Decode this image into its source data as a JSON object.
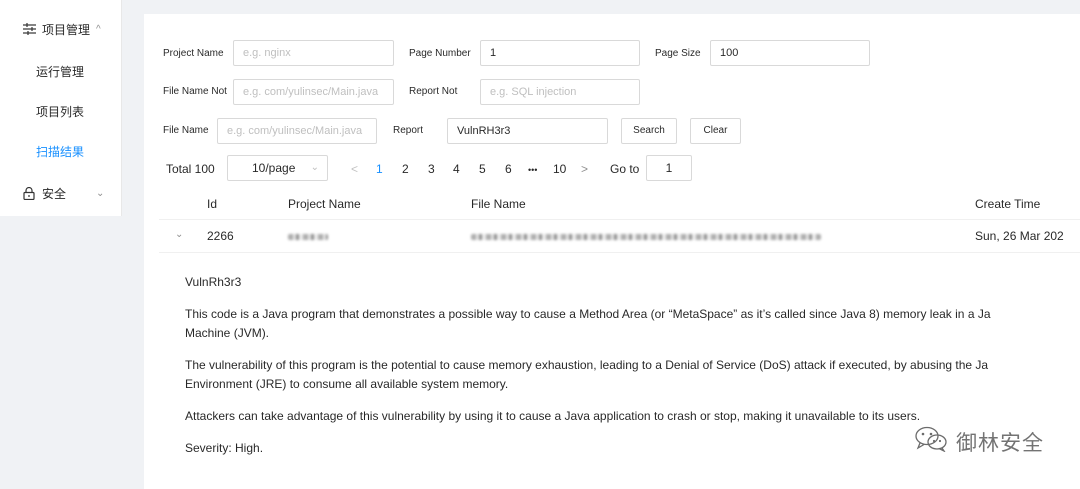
{
  "sidebar": {
    "group_project": {
      "label": "项目管理",
      "arrow": "^"
    },
    "items": [
      {
        "label": "运行管理"
      },
      {
        "label": "项目列表"
      },
      {
        "label": "扫描结果",
        "active": true
      }
    ],
    "group_security": {
      "label": "安全",
      "arrow": "⌄"
    }
  },
  "filters": {
    "project_name": {
      "label": "Project Name",
      "placeholder": "e.g. nginx",
      "value": ""
    },
    "page_number": {
      "label": "Page Number",
      "value": "1"
    },
    "page_size": {
      "label": "Page Size",
      "value": "100"
    },
    "file_name_not": {
      "label": "File Name Not",
      "placeholder": "e.g. com/yulinsec/Main.java",
      "value": ""
    },
    "report_not": {
      "label": "Report Not",
      "placeholder": "e.g. SQL injection",
      "value": ""
    },
    "file_name": {
      "label": "File Name",
      "placeholder": "e.g. com/yulinsec/Main.java",
      "value": ""
    },
    "report": {
      "label": "Report",
      "value": "VulnRH3r3"
    },
    "search_label": "Search",
    "clear_label": "Clear"
  },
  "pagination": {
    "total": "Total 100",
    "page_size_select": "10/page",
    "prev": "<",
    "pages": [
      "1",
      "2",
      "3",
      "4",
      "5",
      "6"
    ],
    "ellipsis": "•••",
    "last": "10",
    "next": ">",
    "goto_label": "Go to",
    "goto_value": "1"
  },
  "table": {
    "columns": [
      "Id",
      "Project Name",
      "File Name",
      "Create Time"
    ],
    "rows": [
      {
        "id": "2266",
        "create_time": "Sun, 26 Mar 202"
      }
    ]
  },
  "detail": {
    "title": "VulnRh3r3",
    "p1a": "This code is a Java program that demonstrates a possible way to cause a Method Area (or “MetaSpace” as it’s called since Java 8) memory leak in a Ja",
    "p1b": "Machine (JVM).",
    "p2a": "The vulnerability of this program is the potential to cause memory exhaustion, leading to a Denial of Service (DoS) attack if executed, by abusing the Ja",
    "p2b": "Environment (JRE) to consume all available system memory.",
    "p3": "Attackers can take advantage of this vulnerability by using it to cause a Java application to crash or stop, making it unavailable to its users.",
    "severity": "Severity: High."
  },
  "watermark": {
    "text": "御林安全"
  },
  "colors": {
    "accent": "#1890ff",
    "background": "#f0f2f5"
  },
  "icons": [
    "sliders-icon",
    "lock-icon",
    "chevron-up-icon",
    "chevron-down-icon",
    "wechat-icon"
  ]
}
